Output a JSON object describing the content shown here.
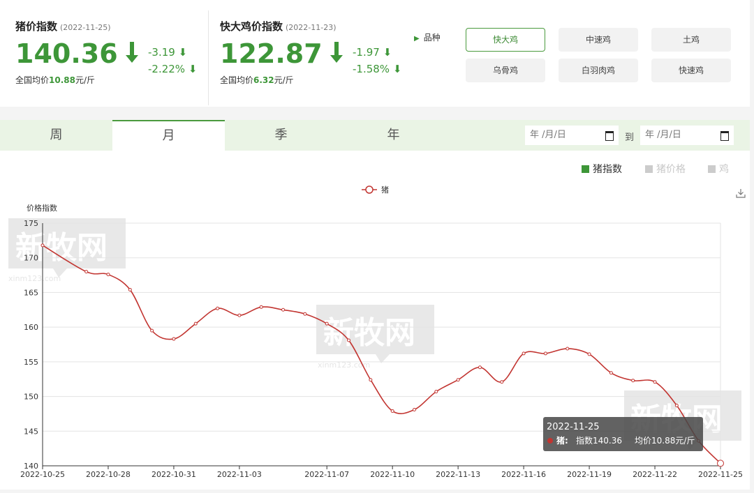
{
  "pig_index": {
    "title": "猪价指数",
    "date": "(2022-11-25)",
    "value": "140.36",
    "change_abs": "-3.19",
    "change_pct": "-2.22%",
    "avg_prefix": "全国均价",
    "avg_value": "10.88",
    "avg_unit": "元/斤"
  },
  "chicken_index": {
    "title": "快大鸡价指数",
    "date": "(2022-11-23)",
    "value": "122.87",
    "change_abs": "-1.97",
    "change_pct": "-1.58%",
    "avg_prefix": "全国均价",
    "avg_value": "6.32",
    "avg_unit": "元/斤"
  },
  "breeds": {
    "label": "品种",
    "items": [
      "快大鸡",
      "中速鸡",
      "土鸡",
      "乌骨鸡",
      "白羽肉鸡",
      "快速鸡"
    ],
    "selected": "快大鸡"
  },
  "tabs": [
    "周",
    "月",
    "季",
    "年"
  ],
  "active_tab": "月",
  "date_range": {
    "from_placeholder": "年 /月/日",
    "to_label": "到",
    "to_placeholder": "年 /月/日"
  },
  "toggles": [
    "猪指数",
    "猪价格",
    "鸡"
  ],
  "colors": {
    "accent_green": "#3d9638",
    "series_red": "#c23531",
    "toggle_off": "#cccccc"
  },
  "tooltip": {
    "date": "2022-11-25",
    "series": "猪:",
    "index_text": "指数140.36",
    "avg_text": "均价10.88元/斤"
  },
  "watermark": {
    "text": "新牧网",
    "domain": "xinm123.com"
  },
  "chart_data": {
    "type": "line",
    "ylabel": "价格指数",
    "ylim": [
      140,
      175
    ],
    "yticks": [
      140,
      145,
      150,
      155,
      160,
      165,
      170,
      175
    ],
    "grid": true,
    "legend": "top-center",
    "x": [
      "2022-10-25",
      "2022-10-26",
      "2022-10-27",
      "2022-10-28",
      "2022-10-29",
      "2022-10-30",
      "2022-10-31",
      "2022-11-01",
      "2022-11-02",
      "2022-11-03",
      "2022-11-04",
      "2022-11-05",
      "2022-11-06",
      "2022-11-07",
      "2022-11-08",
      "2022-11-09",
      "2022-11-10",
      "2022-11-11",
      "2022-11-12",
      "2022-11-13",
      "2022-11-14",
      "2022-11-15",
      "2022-11-16",
      "2022-11-17",
      "2022-11-18",
      "2022-11-19",
      "2022-11-20",
      "2022-11-21",
      "2022-11-22",
      "2022-11-23",
      "2022-11-24",
      "2022-11-25"
    ],
    "xtick_labels": [
      "2022-10-25",
      "2022-10-28",
      "2022-10-31",
      "2022-11-03",
      "2022-11-07",
      "2022-11-10",
      "2022-11-13",
      "2022-11-16",
      "2022-11-19",
      "2022-11-22",
      "2022-11-25"
    ],
    "series": [
      {
        "name": "猪",
        "values": [
          171.8,
          168.0,
          167.6,
          165.4,
          159.5,
          158.3,
          160.5,
          162.7,
          161.7,
          162.9,
          162.5,
          161.9,
          160.5,
          158.1,
          152.4,
          147.9,
          148.1,
          150.7,
          152.4,
          154.2,
          152.1,
          156.2,
          156.2,
          156.9,
          156.1,
          153.4,
          152.3,
          152.1,
          148.7,
          143.6,
          140.36
        ]
      }
    ]
  }
}
